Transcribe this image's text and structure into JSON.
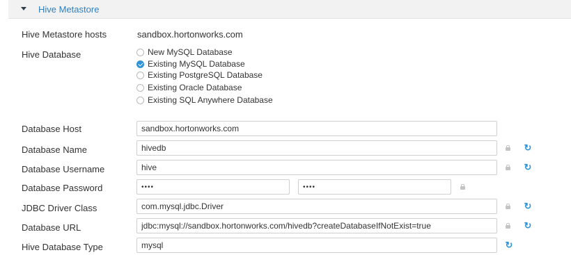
{
  "section": {
    "title": "Hive Metastore"
  },
  "hosts": {
    "label": "Hive Metastore hosts",
    "value": "sandbox.hortonworks.com"
  },
  "database": {
    "label": "Hive Database",
    "options": [
      {
        "label": "New MySQL Database",
        "checked": false
      },
      {
        "label": "Existing MySQL Database",
        "checked": true
      },
      {
        "label": "Existing PostgreSQL Database",
        "checked": false
      },
      {
        "label": "Existing Oracle Database",
        "checked": false
      },
      {
        "label": "Existing SQL Anywhere Database",
        "checked": false
      }
    ]
  },
  "fields": {
    "db_host": {
      "label": "Database Host",
      "value": "sandbox.hortonworks.com"
    },
    "db_name": {
      "label": "Database Name",
      "value": "hivedb"
    },
    "db_user": {
      "label": "Database Username",
      "value": "hive"
    },
    "db_password": {
      "label": "Database Password",
      "value": "••••",
      "confirm": "••••"
    },
    "jdbc_driver": {
      "label": "JDBC Driver Class",
      "value": "com.mysql.jdbc.Driver"
    },
    "db_url": {
      "label": "Database URL",
      "value": "jdbc:mysql://sandbox.hortonworks.com/hivedb?createDatabaseIfNotExist=true"
    },
    "db_type": {
      "label": "Hive Database Type",
      "value": "mysql"
    }
  },
  "icons": {
    "refresh": "↻",
    "lock": "lock-icon"
  },
  "colors": {
    "accent": "#2f93d8",
    "link": "#2f7fc0",
    "header_bg": "#f2f2f2"
  }
}
